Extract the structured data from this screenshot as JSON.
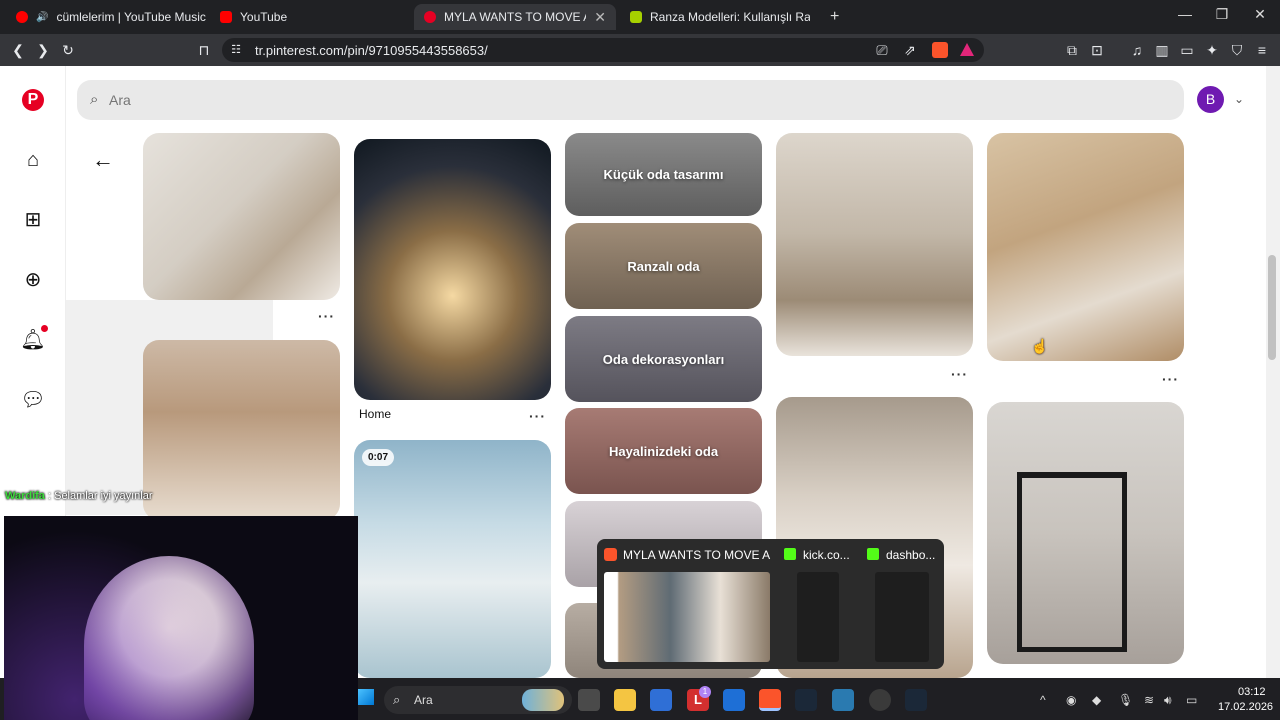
{
  "browser": {
    "tabs": [
      {
        "label": "cümlelerim | YouTube Music",
        "active": false
      },
      {
        "label": "YouTube",
        "active": false
      },
      {
        "label": "MYLA WANTS TO MOVE AND GI",
        "active": true
      },
      {
        "label": "Ranza Modelleri: Kullanışlı Ranza Fiya",
        "active": false
      }
    ],
    "new_tab": "+",
    "url": "tr.pinterest.com/pin/9710955443558653/"
  },
  "pinterest": {
    "search_placeholder": "Ara",
    "avatar_initial": "B",
    "pin_titles": {
      "home": "Home"
    },
    "video_badge": "0:07",
    "categories": [
      "Küçük oda tasarımı",
      "Ranzalı oda",
      "Oda dekorasyonları",
      "Hayalinizdeki oda"
    ],
    "more_dots": "···"
  },
  "overlay": {
    "chat_user": "Wardifa",
    "chat_message": " : Selamlar iyi yayınlar"
  },
  "task_preview": {
    "items": [
      {
        "label": "MYLA WANTS TO MOVE A..."
      },
      {
        "label": "kick.co..."
      },
      {
        "label": "dashbo..."
      }
    ]
  },
  "taskbar": {
    "search_label": "Ara",
    "time": "03:12",
    "date": "17.02.2026",
    "badge_count": "1"
  }
}
